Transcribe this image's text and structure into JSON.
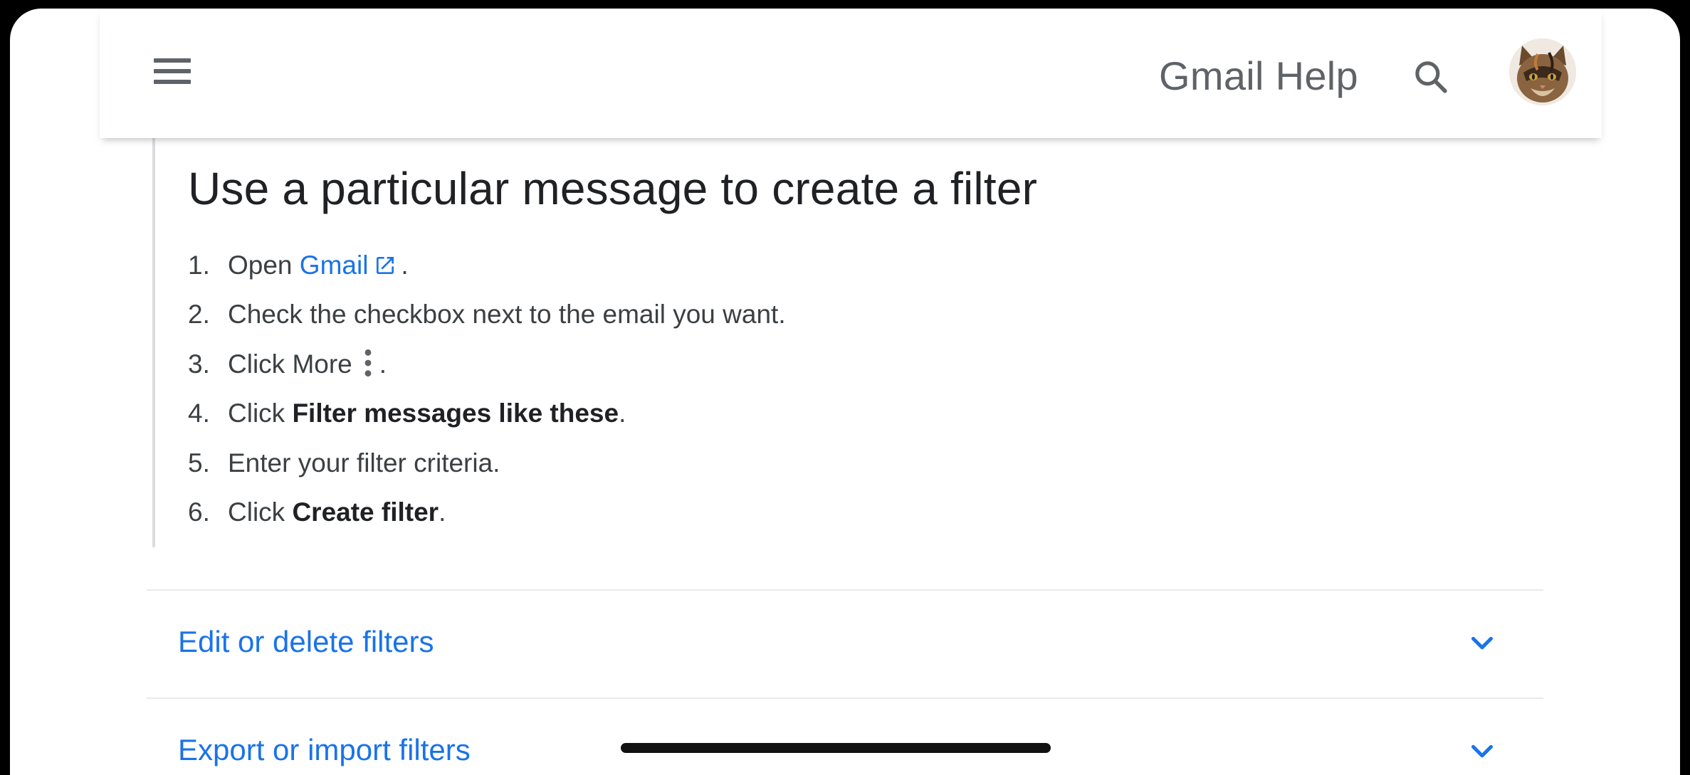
{
  "header": {
    "title": "Gmail Help",
    "menu_icon": "hamburger-menu-icon",
    "search_icon": "search-icon",
    "avatar_icon": "cat-avatar"
  },
  "article": {
    "title": "Use a particular message to create a filter",
    "steps": [
      {
        "num": "1.",
        "pre": "Open",
        "link": "Gmail",
        "post": "."
      },
      {
        "num": "2.",
        "text": "Check the checkbox next to the email you want."
      },
      {
        "num": "3.",
        "pre": "Click More",
        "post": "."
      },
      {
        "num": "4.",
        "pre": "Click ",
        "bold": "Filter messages like these",
        "post": "."
      },
      {
        "num": "5.",
        "text": "Enter your filter criteria."
      },
      {
        "num": "6.",
        "pre": "Click ",
        "bold": "Create filter",
        "post": "."
      }
    ]
  },
  "accordions": [
    {
      "label": "Edit or delete filters"
    },
    {
      "label": "Export or import filters"
    }
  ],
  "colors": {
    "link": "#1a73e8",
    "text": "#3c4043",
    "icon": "#5f6368"
  }
}
